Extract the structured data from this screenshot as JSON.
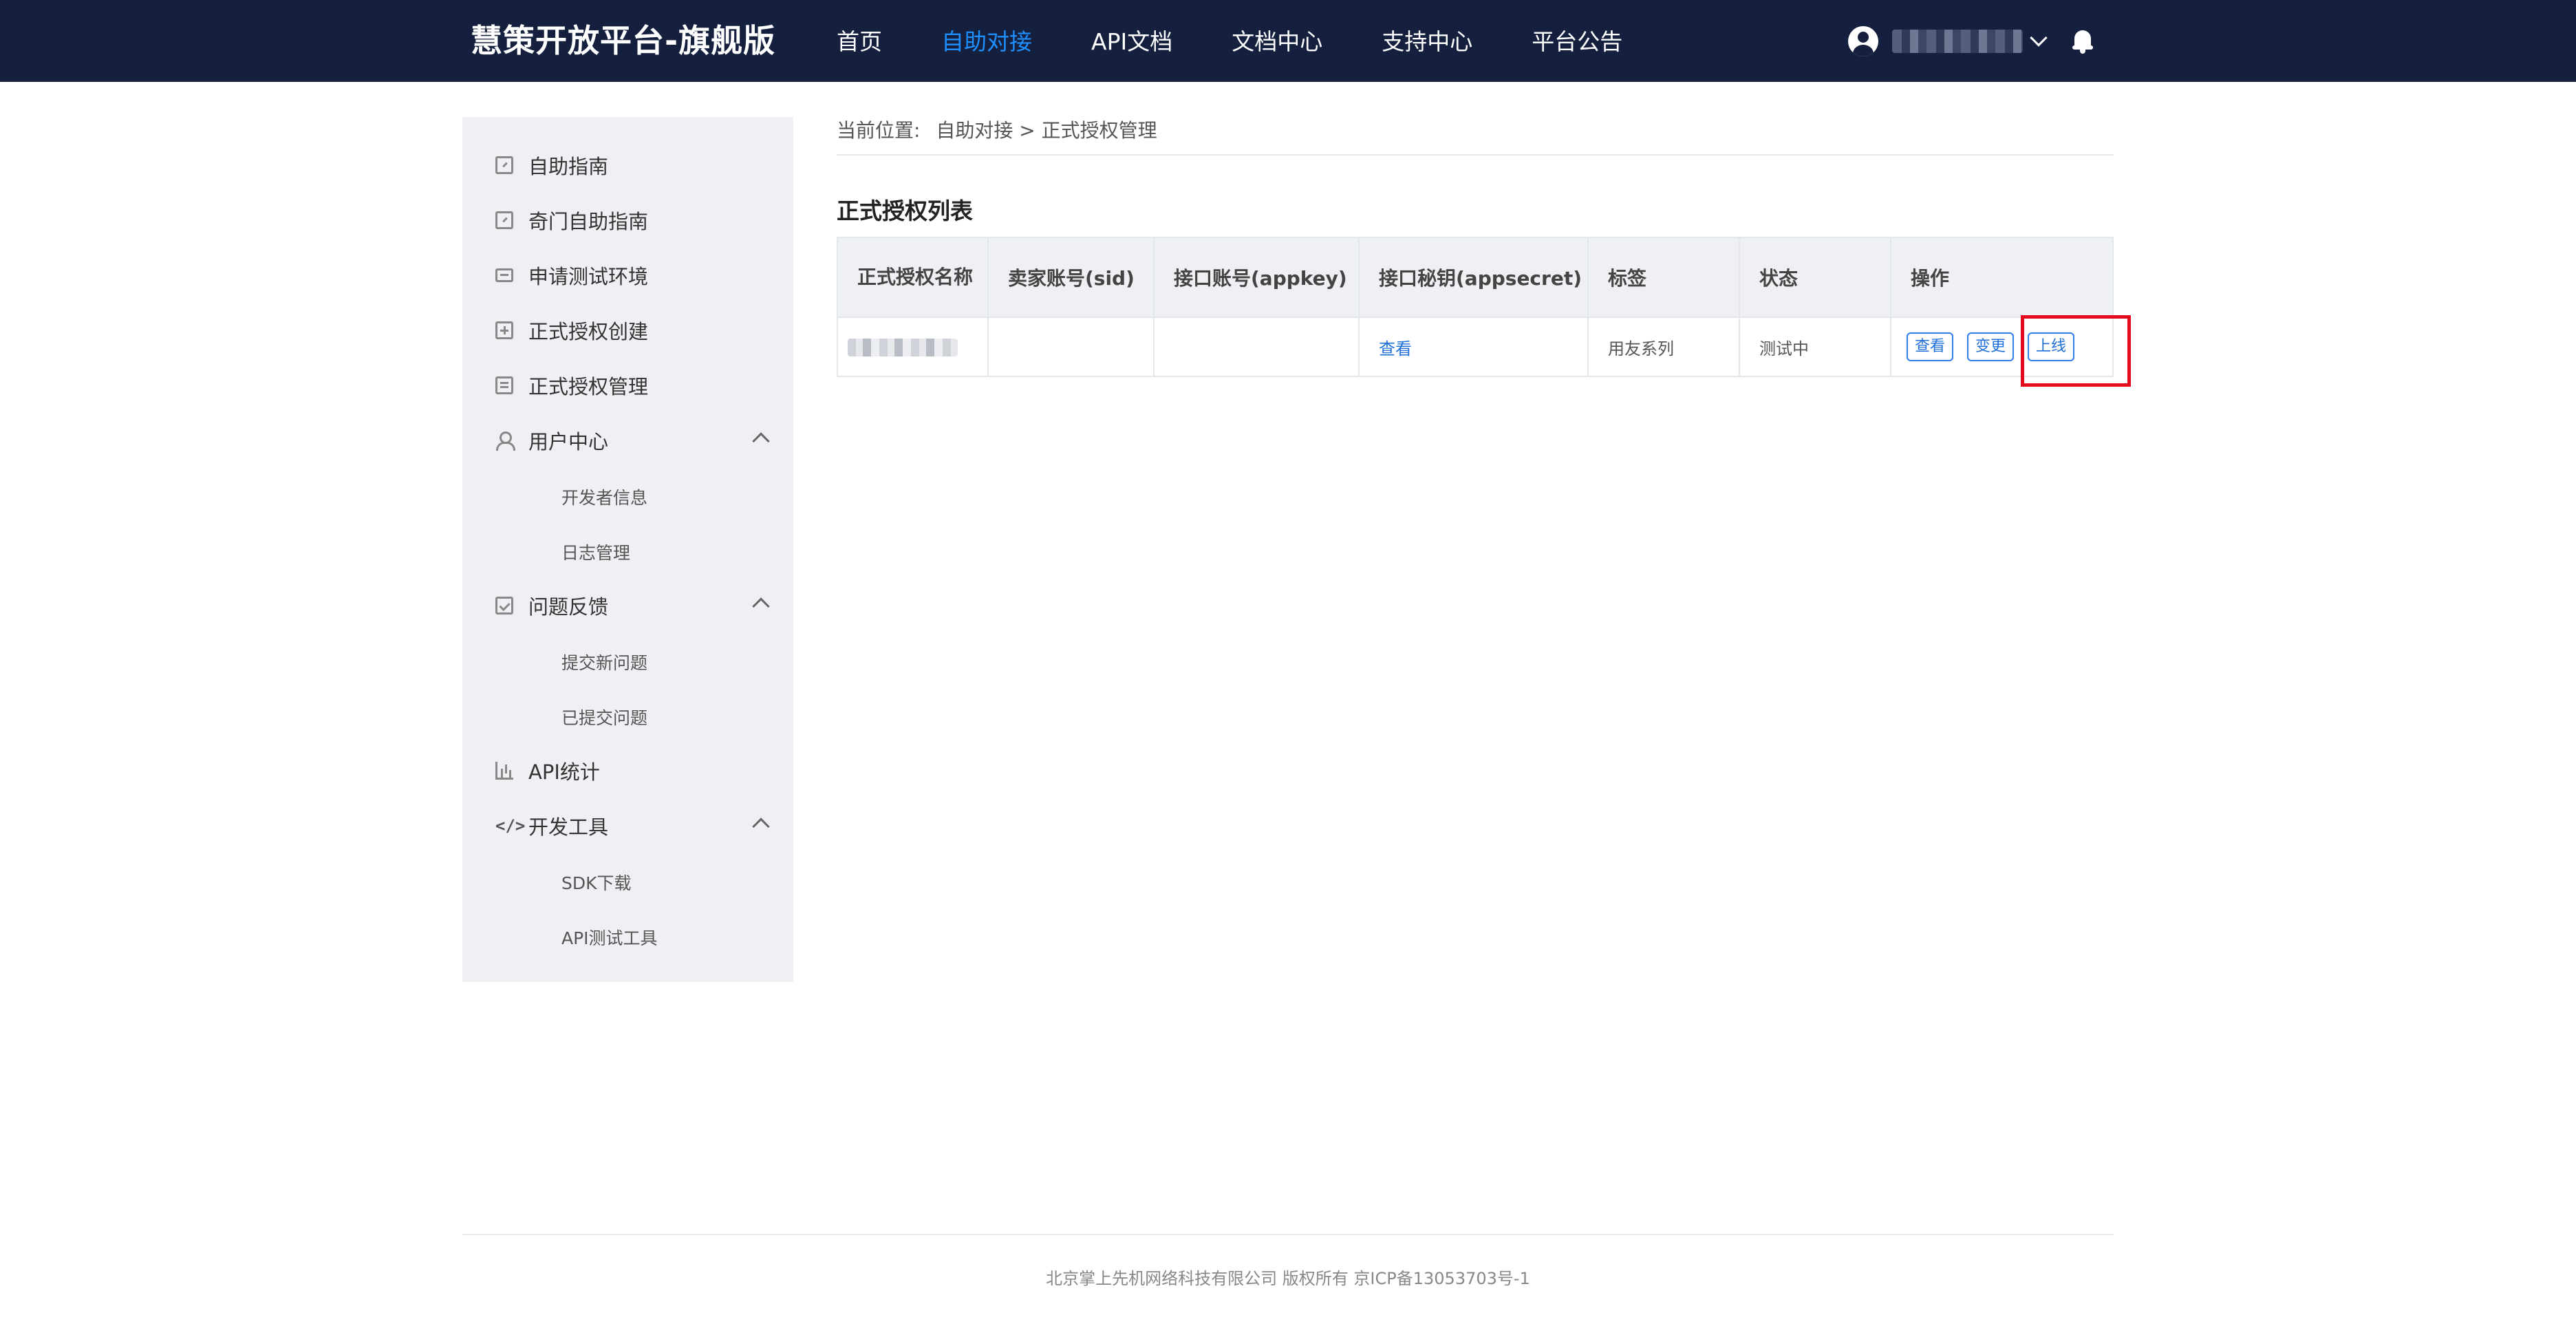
{
  "header": {
    "brand": "慧策开放平台-旗舰版",
    "nav": [
      "首页",
      "自助对接",
      "API文档",
      "文档中心",
      "支持中心",
      "平台公告"
    ],
    "active_nav": "自助对接"
  },
  "sidebar": {
    "items": [
      {
        "label": "自助指南",
        "icon": "doc-edit-icon"
      },
      {
        "label": "奇门自助指南",
        "icon": "doc-edit-icon"
      },
      {
        "label": "申请测试环境",
        "icon": "monitor-icon"
      },
      {
        "label": "正式授权创建",
        "icon": "plus-box-icon"
      },
      {
        "label": "正式授权管理",
        "icon": "stack-icon"
      },
      {
        "label": "用户中心",
        "icon": "user-icon",
        "expanded": true,
        "children": [
          "开发者信息",
          "日志管理"
        ]
      },
      {
        "label": "问题反馈",
        "icon": "check-box-icon",
        "expanded": true,
        "children": [
          "提交新问题",
          "已提交问题"
        ]
      },
      {
        "label": "API统计",
        "icon": "bar-chart-icon"
      },
      {
        "label": "开发工具",
        "icon": "code-icon",
        "expanded": true,
        "children": [
          "SDK下载",
          "API测试工具"
        ]
      }
    ]
  },
  "breadcrumb": {
    "prefix": "当前位置:",
    "path": "自助对接 > 正式授权管理"
  },
  "main": {
    "title": "正式授权列表",
    "table": {
      "headers": [
        "正式授权名称",
        "卖家账号(sid)",
        "接口账号(appkey)",
        "接口秘钥(appsecret)",
        "标签",
        "状态",
        "操作"
      ],
      "rows": [
        {
          "name": "",
          "sid": "",
          "appkey": "",
          "appsecret_link": "查看",
          "tag": "用友系列",
          "status": "测试中",
          "actions": [
            "查看",
            "变更",
            "上线"
          ]
        }
      ]
    }
  },
  "footer": {
    "text": "北京掌上先机网络科技有限公司 版权所有 京ICP备13053703号-1"
  },
  "colors": {
    "header_bg": "#15203f",
    "active_nav": "#1e8fff",
    "sidebar_bg": "#eef0f3",
    "link": "#1e6fd9",
    "highlight": "#e30b1c"
  }
}
